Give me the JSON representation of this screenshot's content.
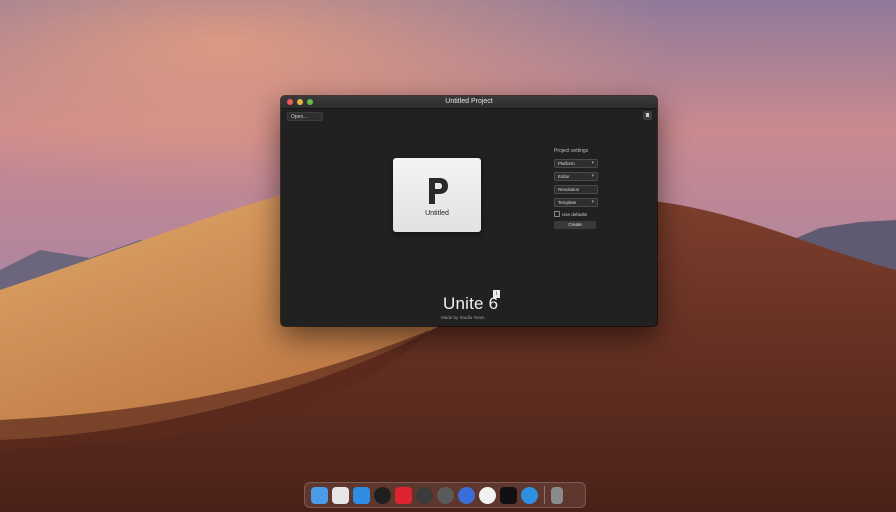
{
  "window": {
    "title": "Untitled Project",
    "toolbar_button": "Open...",
    "project_card_label": "Untitled",
    "panel": {
      "heading": "Project settings",
      "options": [
        "Platform",
        "Editor",
        "Resolution",
        "Template"
      ],
      "checkbox_label": "Use defaults",
      "action_button": "Create"
    },
    "brand": {
      "name": "Unite 6",
      "badge": "i",
      "subtitle": "Made by Studio Team"
    }
  },
  "dock": {
    "icons": [
      {
        "name": "finder-icon",
        "color": "#4a9be8"
      },
      {
        "name": "photos-icon",
        "color": "#e6e6e6"
      },
      {
        "name": "appstore-icon",
        "color": "#2f8de4"
      },
      {
        "name": "safari-icon",
        "color": "#1f1f1f"
      },
      {
        "name": "music-icon",
        "color": "#e0242f"
      },
      {
        "name": "settings-icon",
        "color": "#3b3b3b"
      },
      {
        "name": "system-icon",
        "color": "#5a5a5a"
      },
      {
        "name": "xcode-icon",
        "color": "#3a6fd8"
      },
      {
        "name": "chrome-icon",
        "color": "#f2f2f2"
      },
      {
        "name": "terminal-icon",
        "color": "#111111"
      },
      {
        "name": "network-icon",
        "color": "#2e8fe0"
      }
    ],
    "trash": {
      "name": "trash-icon",
      "color": "#8b8b8b"
    }
  }
}
